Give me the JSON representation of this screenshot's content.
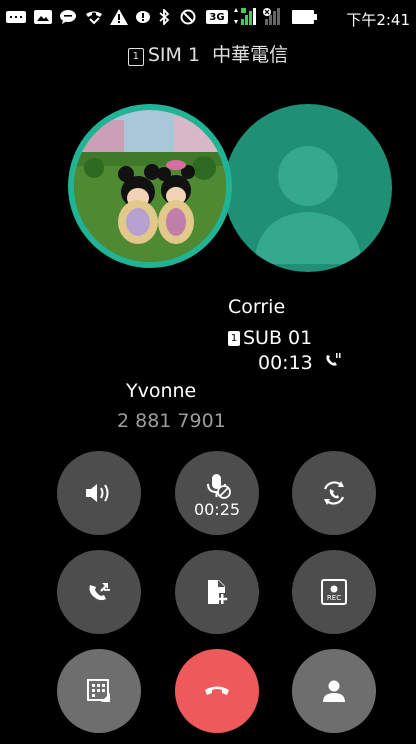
{
  "statusbar": {
    "time": "下午2:41",
    "network_badge": "3G"
  },
  "sim": {
    "badge": "1",
    "label": "SIM 1",
    "carrier": "中華電信"
  },
  "call": {
    "active_contact": "Corrie",
    "sub_badge": "1",
    "sub_label": "SUB 01",
    "active_timer": "00:13",
    "held_contact": "Yvonne",
    "held_number": "2 881 7901"
  },
  "controls": {
    "mute_timer": "00:25"
  },
  "colors": {
    "accent_ring": "#20b497",
    "secondary_avatar": "#1f8f76",
    "end_call": "#ee5a5c"
  }
}
